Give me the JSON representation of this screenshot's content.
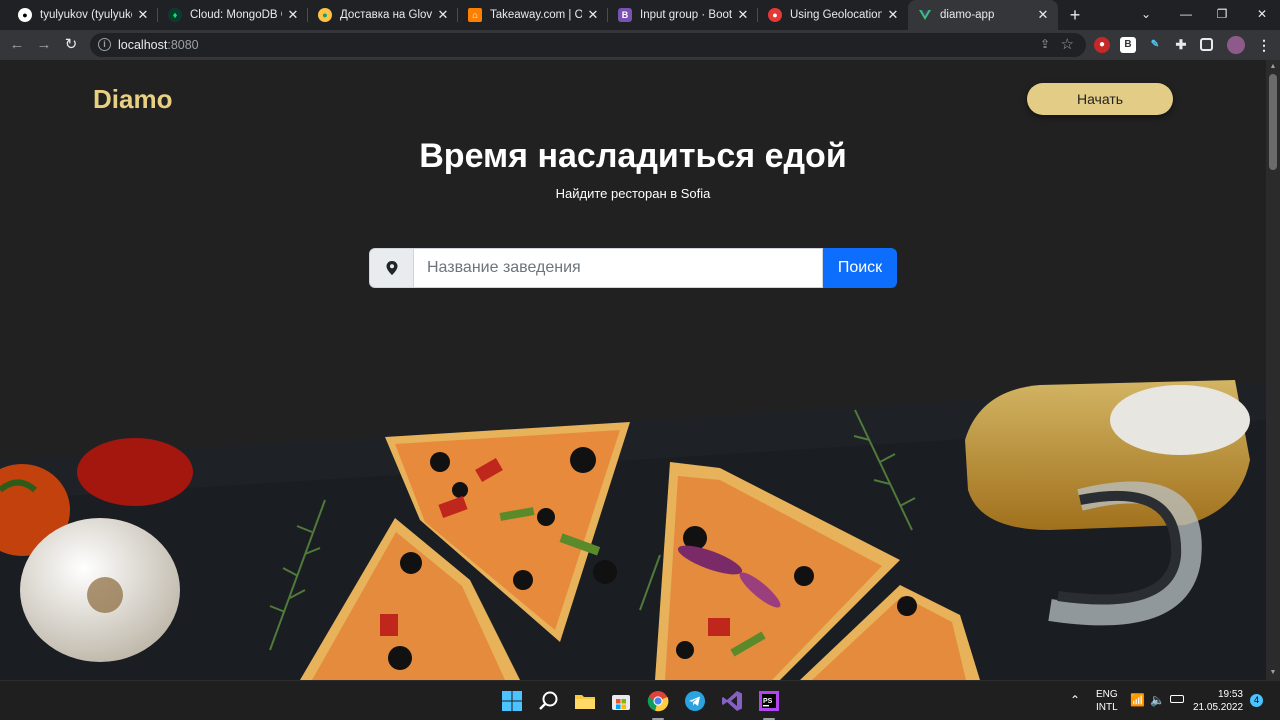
{
  "browser": {
    "tabs": [
      {
        "title": "tyulyukov (tyulyukov)",
        "icon": "github-icon",
        "color": "#ffffff"
      },
      {
        "title": "Cloud: MongoDB Clo",
        "icon": "mongodb-icon",
        "color": "#00ed64"
      },
      {
        "title": "Доставка на Glovo в",
        "icon": "glovo-icon",
        "color": "#ffc244"
      },
      {
        "title": "Takeaway.com | Order",
        "icon": "takeaway-icon",
        "color": "#ff8000"
      },
      {
        "title": "Input group · Bootstra",
        "icon": "bootstrap-icon",
        "color": "#7952b3"
      },
      {
        "title": "Using Geolocation wi",
        "icon": "geolocation-icon",
        "color": "#e53935"
      },
      {
        "title": "diamo-app",
        "icon": "vue-icon",
        "color": "#41b883"
      }
    ],
    "url_host": "localhost",
    "url_port": ":8080"
  },
  "page": {
    "logo": "Diamo",
    "start_button": "Начать",
    "title": "Время насладиться едой",
    "subtitle": "Найдите ресторан в Sofia",
    "search_placeholder": "Название заведения",
    "search_button": "Поиск",
    "accent_color": "#e3cd86",
    "primary_color": "#0d6efd"
  },
  "taskbar": {
    "lang_top": "ENG",
    "lang_bottom": "INTL",
    "time": "19:53",
    "date": "21.05.2022",
    "notifications": "4"
  }
}
